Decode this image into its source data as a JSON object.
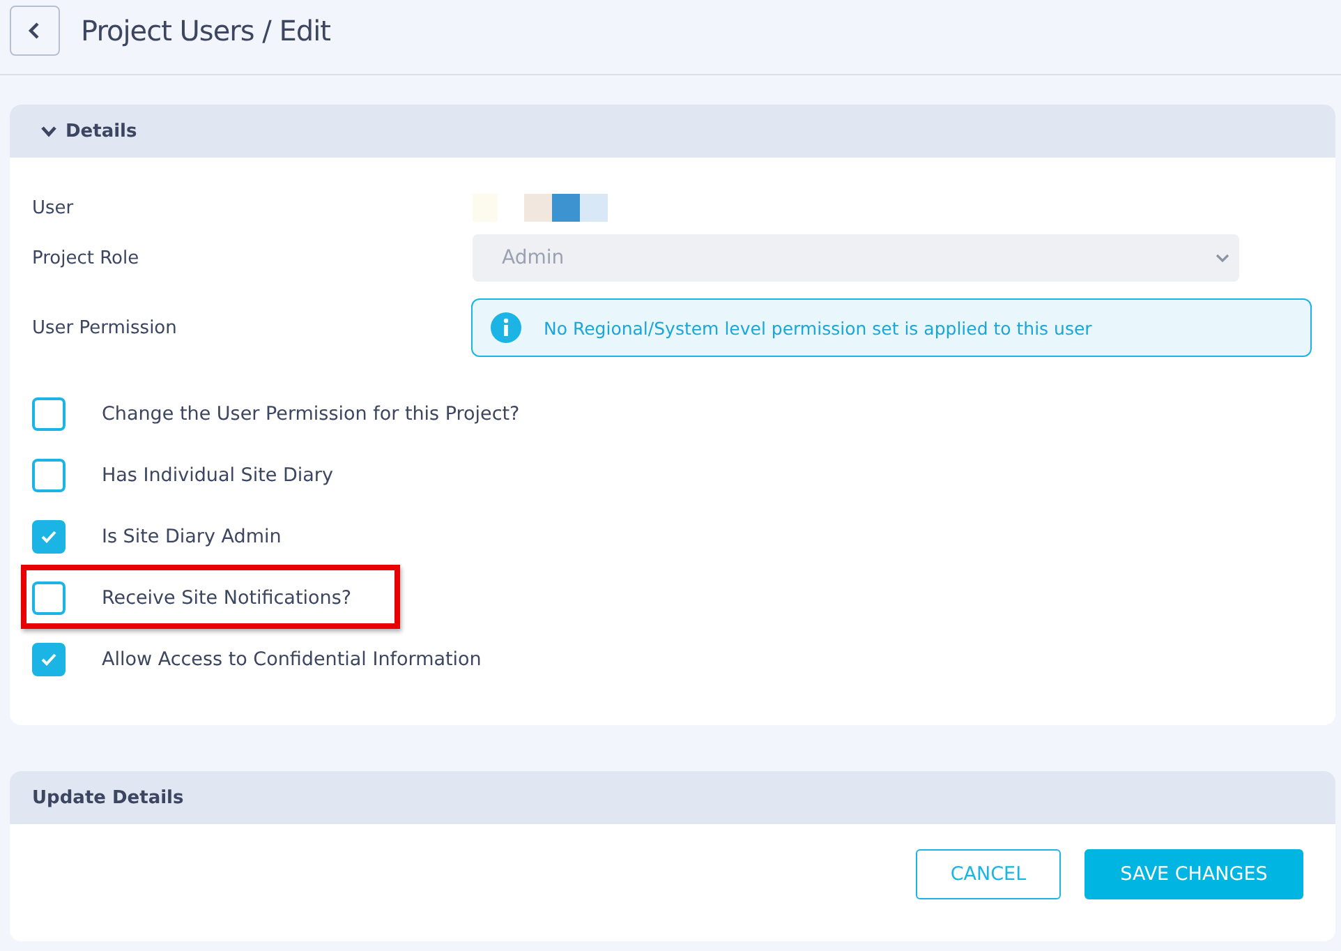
{
  "header": {
    "title": "Project Users",
    "subtitle": "/ Edit"
  },
  "details": {
    "title": "Details",
    "expanded": true,
    "fields": [
      {
        "kind": "obscured",
        "label": "User"
      },
      {
        "kind": "select",
        "label": "Project Role",
        "value": "Admin",
        "disabled": true
      },
      {
        "kind": "alert",
        "label": "User Permission",
        "message": "No Regional/System level permission set is applied to this user"
      }
    ],
    "checkboxes": [
      {
        "label": "Change the User Permission for this Project?",
        "checked": false,
        "highlighted": false
      },
      {
        "label": "Has Individual Site Diary",
        "checked": false,
        "highlighted": false
      },
      {
        "label": "Is Site Diary Admin",
        "checked": true,
        "highlighted": false
      },
      {
        "label": "Receive Site Notifications?",
        "checked": false,
        "highlighted": true
      },
      {
        "label": "Allow Access to Confidential Information",
        "checked": true,
        "highlighted": false
      }
    ]
  },
  "update": {
    "title": "Update Details",
    "buttons": [
      {
        "kind": "outline",
        "label": "CANCEL"
      },
      {
        "kind": "primary",
        "label": "SAVE CHANGES"
      }
    ]
  }
}
